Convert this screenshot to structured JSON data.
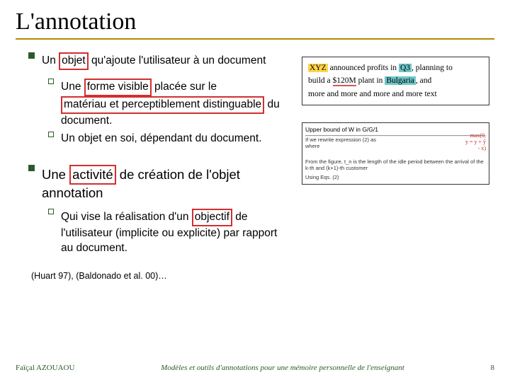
{
  "title": "L'annotation",
  "bullets": {
    "first": {
      "pre": "Un ",
      "boxed": "objet",
      "post": " qu'ajoute l'utilisateur à un document",
      "subs": [
        {
          "pre": "Une ",
          "box1": "forme visible",
          "mid1": " placée sur le ",
          "box2": "matériau et perceptiblement distinguable",
          "post": " du document."
        },
        {
          "text": "Un objet en soi, dépendant du document."
        }
      ]
    },
    "second": {
      "pre": " Une ",
      "boxed": "activité",
      "post": " de création de l'objet annotation",
      "sub": {
        "pre": "Qui vise la réalisation d'un ",
        "boxed": "objectif",
        "post": " de l'utilisateur (implicite ou explicite) par rapport au document."
      }
    }
  },
  "ref": "(Huart 97), (Baldonado et al. 00)…",
  "figure1": {
    "l1a": "XYZ",
    "l1b": " announced profits in ",
    "l1c": "Q3",
    "l1d": ", planning to",
    "l2a": "build a ",
    "l2b": "$120M",
    "l2c": " plant in ",
    "l2d": "Bulgaria",
    "l2e": ",   and",
    "l3": "more and more and more and more text"
  },
  "figure2": {
    "caption": "Upper bound of W in G/G/1",
    "line1": "If we rewrite expression (2) as",
    "scribble1": "max(0,",
    "scribble2": "y = y + ŷ",
    "scribble3": "- x)",
    "line2": "where",
    "line3": "From the figure, t_n is the length of the idle period between the arrival of the k-th and (k+1)-th customer",
    "line4": "Using Eqs. (2)"
  },
  "footer": {
    "author": "Faïçal AZOUAOU",
    "title": "Modèles et outils d'annotations pour une mémoire personnelle de l'enseignant",
    "page": "8"
  }
}
